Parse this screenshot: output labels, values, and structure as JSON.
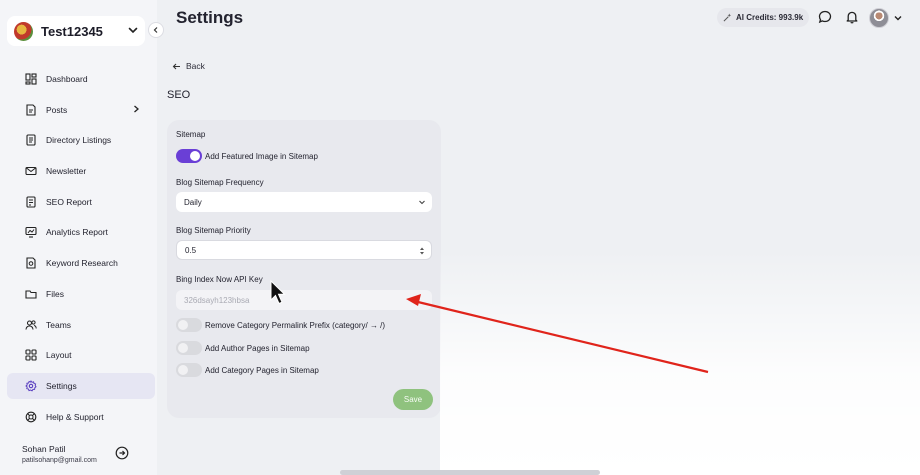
{
  "workspace": {
    "name": "Test12345"
  },
  "sidebar": {
    "items": [
      {
        "label": "Dashboard",
        "icon": "dashboard-icon"
      },
      {
        "label": "Posts",
        "icon": "posts-icon"
      },
      {
        "label": "Directory Listings",
        "icon": "directory-icon"
      },
      {
        "label": "Newsletter",
        "icon": "mail-icon"
      },
      {
        "label": "SEO Report",
        "icon": "seo-report-icon"
      },
      {
        "label": "Analytics Report",
        "icon": "analytics-icon"
      },
      {
        "label": "Keyword Research",
        "icon": "keyword-icon"
      },
      {
        "label": "Files",
        "icon": "folder-icon"
      },
      {
        "label": "Teams",
        "icon": "teams-icon"
      },
      {
        "label": "Layout",
        "icon": "layout-icon"
      },
      {
        "label": "Settings",
        "icon": "gear-icon",
        "active": true
      },
      {
        "label": "Help & Support",
        "icon": "help-icon"
      }
    ],
    "user": {
      "name": "Sohan Patil",
      "email": "patilsohanp@gmail.com"
    }
  },
  "header": {
    "title": "Settings",
    "credits": "AI Credits: 993.9k"
  },
  "content": {
    "back_label": "Back",
    "section_title": "SEO",
    "sitemap": {
      "heading": "Sitemap",
      "featured_image": {
        "label": "Add Featured Image in Sitemap",
        "on": true
      }
    },
    "frequency": {
      "label": "Blog Sitemap Frequency",
      "value": "Daily"
    },
    "priority": {
      "label": "Blog Sitemap Priority",
      "value": "0.5"
    },
    "bing": {
      "label": "Bing Index Now API Key",
      "placeholder": "326dsayh123hbsa"
    },
    "toggles": [
      {
        "label": "Remove Category Permalink Prefix (category/ → /)",
        "on": false
      },
      {
        "label": "Add Author Pages in Sitemap",
        "on": false
      },
      {
        "label": "Add Category Pages in Sitemap",
        "on": false
      }
    ],
    "save_label": "Save"
  },
  "colors": {
    "accent": "#6a3fd6",
    "save_button": "#8fc27e",
    "annotation_arrow": "#e0241b"
  }
}
